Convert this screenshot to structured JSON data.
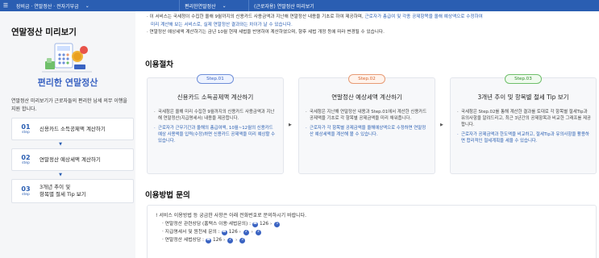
{
  "topbar": {
    "menu_icon": "menu-icon",
    "crumbs": [
      "장비금 · 연말정산 · 전자기부금",
      "편리한연말정산",
      "(근로자용) 연말정산 미리보기"
    ]
  },
  "sidebar": {
    "title": "연말정산 미리보기",
    "brand": "편리한 연말정산",
    "description": "연말정산 미리보기가 근로자들의  편리한 납세 의무 이행을 지원 합니다.",
    "steps": [
      {
        "num": "01",
        "step": "step",
        "label": "신용카드 소득공제액 계산하기"
      },
      {
        "num": "02",
        "step": "step",
        "label": "연말정산 예상세액 계산하기"
      },
      {
        "num": "03",
        "step": "step",
        "label1": "3개년 추이 및",
        "label2": "항목별 절세 Tip 보기"
      }
    ]
  },
  "notice": {
    "line1_a": "· 이 서비스는 국세청이 수집한 올해 9월까지의 신용카드 사용금액과 지난해 연말정산 내용을 기초로 하여 제공하며,",
    "line1_b": "근로자가 총급여 및 각종 공제항목을 올해 예상액으로 수정하여",
    "line2": "미리 계산해 보는 서비스로, 실제 연말정산 결과와는 차이가 날 수 있습니다.",
    "line3": "· 연말정산 예상세액 계산하기는 금년 10월 현재 세법을 반영하여 계산하였으며, 향후 세법 개정 등에 따라 변경될 수 있습니다."
  },
  "process": {
    "title": "이용절차",
    "boxes": [
      {
        "pill": "Step.01",
        "title": "신용카드 소득공제액 계산하기",
        "text": "국세청은 올해 미리 수집한 9월까지의 신용카드 사용금액과 지난해 연말정산(지급명세서) 내용을 제공합니다.",
        "blue": "근로자가 근무기간과 올해의 총급여액, 10월~12월의 신용카드 예상 사용액을 입력(수정)하면 신용카드 공제액을 미리 예상할 수 있습니다."
      },
      {
        "pill": "Step.02",
        "title": "연말정산 예상세액 계산하기",
        "text": "국세청은 지난해 연말정산 내용과 Step.01에서 계산한 신용카드 공제액을 기초로 각 항목별 공제금액을 미리 채워줍니다.",
        "blue": "근로자가 각 항목별 공제금액을 올해예상액으로 수정하면 연말정산 예상세액을 계산해 볼 수 있습니다."
      },
      {
        "pill": "Step.03",
        "title": "3개년 추이 및 항목별 절세 Tip 보기",
        "text": "국세청은 Step.02를 통해 계산한 결과를 토대로 각 항목별 절세Tip과 유의사항을 알려드리고, 최근 3년간의 공제항목과 비교한 그래프를 제공합니다.",
        "blue": "근로자가 공제금액과 한도액을 비교하고, 절세Tip과 유의사항을 활용하면 합리적인 절세계획을 세울 수 있습니다."
      }
    ]
  },
  "inquiry": {
    "title": "이용방법 문의",
    "head": "! 서비스 이용방법 등 궁금한 사항은 아래 전화번호로 문의하시기 바랍니다.",
    "lines": [
      {
        "label": "· 연말정산 관련상담 (홈택스 이용·세법문의) : ",
        "num": "126",
        "press": [
          "5"
        ]
      },
      {
        "label": "· 지급명세서 및 원천세 문의 : ",
        "num": "126",
        "press": [
          "2",
          "3"
        ]
      },
      {
        "label": "· 연말정산 세법상담 : ",
        "num": "126",
        "press": [
          "2",
          "3"
        ]
      }
    ]
  },
  "colors": {
    "primary": "#2a5eb2",
    "step2": "#d9662e",
    "step3": "#2f8c2a"
  }
}
